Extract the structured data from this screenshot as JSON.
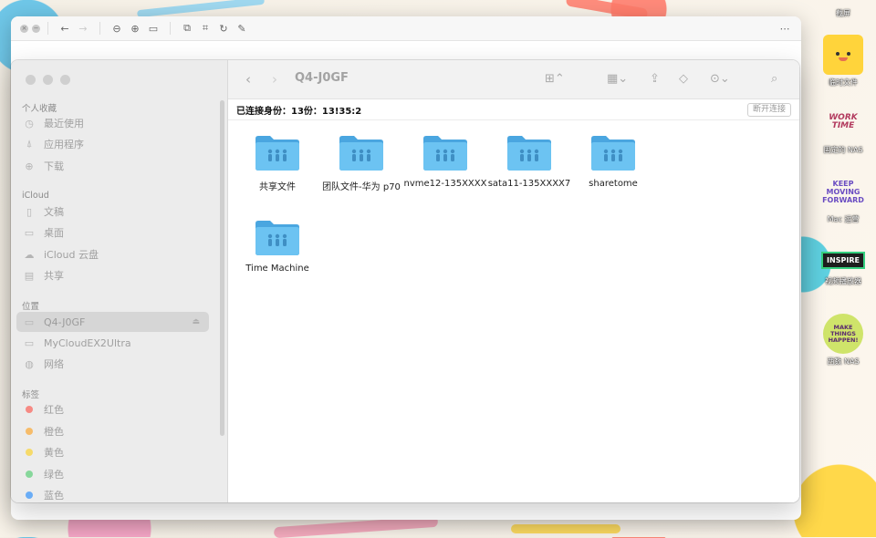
{
  "desktop": {
    "top_label": "截屏",
    "icons": [
      {
        "label": "临时文件",
        "art": "📁"
      },
      {
        "label": "固定的 NAS",
        "art": "WORK TIME"
      },
      {
        "label": "Mac 运营",
        "art": "KEEP MOVING FORWARD"
      },
      {
        "label": "视频播放器",
        "art": "INSPIRE"
      },
      {
        "label": "西数 NAS",
        "art": "MAKE THINGS HAPPEN!"
      }
    ]
  },
  "sidebar": {
    "sections": {
      "favorites": "个人收藏",
      "icloud": "iCloud",
      "locations": "位置",
      "tags": "标签"
    },
    "favorites": [
      {
        "label": "最近使用",
        "icon": "clock-icon"
      },
      {
        "label": "应用程序",
        "icon": "apps-icon"
      },
      {
        "label": "下载",
        "icon": "download-icon"
      }
    ],
    "icloud": [
      {
        "label": "文稿",
        "icon": "document-icon"
      },
      {
        "label": "桌面",
        "icon": "desktop-icon"
      },
      {
        "label": "iCloud 云盘",
        "icon": "cloud-icon"
      },
      {
        "label": "共享",
        "icon": "shared-folder-icon"
      }
    ],
    "locations": [
      {
        "label": "Q4-J0GF",
        "icon": "server-icon",
        "active": true
      },
      {
        "label": "MyCloudEX2Ultra",
        "icon": "server-icon"
      },
      {
        "label": "网络",
        "icon": "network-icon"
      }
    ],
    "tags": [
      {
        "label": "红色",
        "color": "#ff3b30"
      },
      {
        "label": "橙色",
        "color": "#ff9500"
      },
      {
        "label": "黄色",
        "color": "#ffcc00"
      },
      {
        "label": "绿色",
        "color": "#34c759"
      },
      {
        "label": "蓝色",
        "color": "#007aff"
      }
    ]
  },
  "toolbar": {
    "title": "Q4-J0GF"
  },
  "status": {
    "connected_as": "已连接身份：13份：13!35:2",
    "disconnect_label": "断开连接"
  },
  "folders": [
    {
      "name": "共享文件"
    },
    {
      "name": "团队文件-华为 p70"
    },
    {
      "name": "nvme12-135XXXX"
    },
    {
      "name": "sata11-135XXXX7"
    },
    {
      "name": "sharetome"
    },
    {
      "name": "Time Machine"
    }
  ],
  "colors": {
    "folder_blue": "#5cb8ef",
    "folder_blue_dark": "#4aa6e0"
  }
}
